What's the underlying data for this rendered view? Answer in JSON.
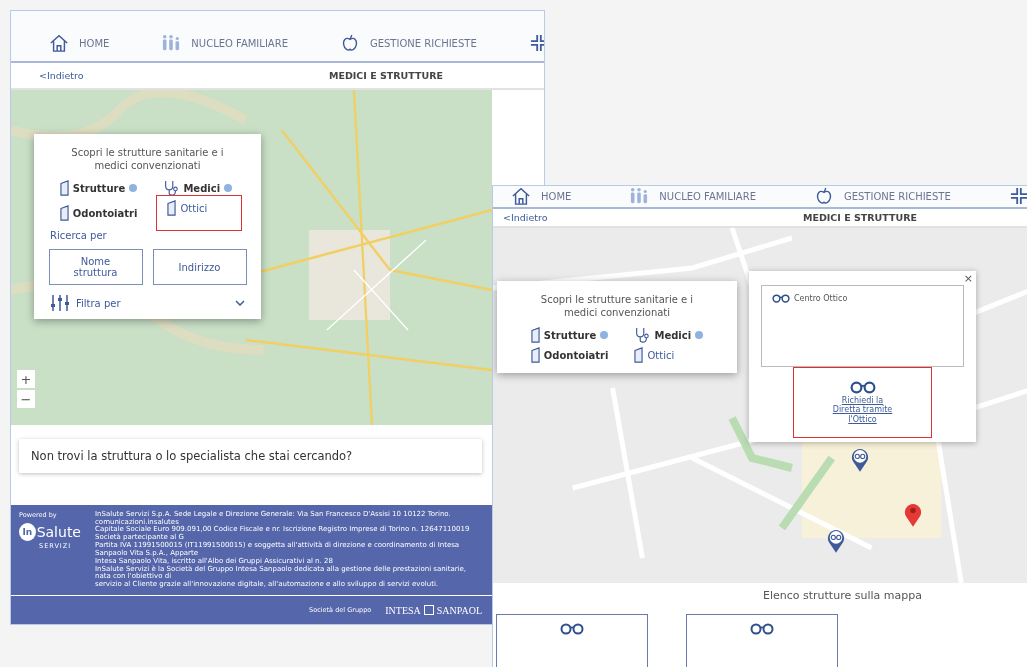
{
  "windows": [
    {
      "nav": [
        {
          "label": "HOME",
          "kind": "home"
        },
        {
          "label": "NUCLEO FAMILIARE",
          "kind": "family"
        },
        {
          "label": "GESTIONE RICHIESTE",
          "kind": "apple"
        },
        {
          "kind": "cross"
        }
      ],
      "back": "<Indietro",
      "title": "MEDICI E STRUTTURE",
      "map": {
        "kind": "terrain",
        "zoom": [
          "+",
          "−"
        ],
        "panel": {
          "intro": "Scopri le strutture sanitarie e i medici convenzionati",
          "categories": [
            {
              "label": "Strutture",
              "kind": "building",
              "info": true,
              "selected": false,
              "highlighted": false
            },
            {
              "label": "Medici",
              "kind": "stethoscope",
              "info": true,
              "selected": false,
              "highlighted": false
            },
            {
              "label": "Odontoiatri",
              "kind": "building",
              "info": false,
              "selected": false,
              "highlighted": false
            },
            {
              "label": "Ottici",
              "kind": "building",
              "info": false,
              "selected": true,
              "highlighted": true
            }
          ],
          "search_label": "Ricerca per",
          "search_buttons": [
            "Nome struttura",
            "Indirizzo"
          ],
          "filter": "Filtra per"
        }
      },
      "question": "Non trovi la struttura o lo specialista che stai cercando?",
      "footer": {
        "powered_by": "Powered by",
        "logo_mark": "In",
        "logo_text": "Salute",
        "logo_sub": "SERVIZI",
        "legal": [
          "InSalute Servizi S.p.A. Sede Legale e Direzione Generale: Via San Francesco D'Assisi 10 10122 Torino. comunicazioni.insalutes",
          "Capitale Sociale Euro 909.091,00 Codice Fiscale e nr. Iscrizione Registro Imprese di Torino n. 12647110019 Società partecipante al G",
          "Partita IVA 11991500015 (IT11991500015) e soggetta all'attività di direzione e coordinamento di Intesa Sanpaolo Vita S.p.A., Apparte",
          "Intesa Sanpaolo Vita, iscritto all'Albo dei Gruppi Assicurativi al n. 28",
          "InSalute Servizi è la Società del Gruppo Intesa Sanpaolo dedicata alla gestione delle prestazioni sanitarie, nata con l'obiettivo di",
          "servizio al Cliente grazie all'innovazione digitale, all'automazione e allo sviluppo di servizi evoluti."
        ],
        "group_label": "Società del Gruppo",
        "group_brand_1": "INTESA",
        "group_brand_2": "SANPAOL"
      }
    },
    {
      "nav": [
        {
          "label": "HOME",
          "kind": "home"
        },
        {
          "label": "NUCLEO FAMILIARE",
          "kind": "family"
        },
        {
          "label": "GESTIONE RICHIESTE",
          "kind": "apple"
        },
        {
          "kind": "cross"
        }
      ],
      "back": "<Indietro",
      "title": "MEDICI E STRUTTURE",
      "map": {
        "kind": "streets",
        "panel": {
          "intro": "Scopri le strutture sanitarie e i medici convenzionati",
          "categories": [
            {
              "label": "Strutture",
              "kind": "building",
              "info": true,
              "selected": false,
              "highlighted": false
            },
            {
              "label": "Medici",
              "kind": "stethoscope",
              "info": true,
              "selected": false,
              "highlighted": false
            },
            {
              "label": "Odontoiatri",
              "kind": "building",
              "info": false,
              "selected": false,
              "highlighted": false
            },
            {
              "label": "Ottici",
              "kind": "building",
              "info": false,
              "selected": true,
              "highlighted": false
            }
          ]
        },
        "popup": {
          "close": "×",
          "items": [
            "Centro Ottico"
          ],
          "link": "Richiedi la Diretta tramite l'Ottico",
          "highlighted": true
        },
        "pins": [
          {
            "kind": "optician"
          },
          {
            "kind": "location"
          },
          {
            "kind": "optician"
          }
        ]
      },
      "list_title": "Elenco strutture sulla mappa",
      "result_cards": [
        {
          "kind": "optician"
        },
        {
          "kind": "optician"
        }
      ]
    }
  ]
}
